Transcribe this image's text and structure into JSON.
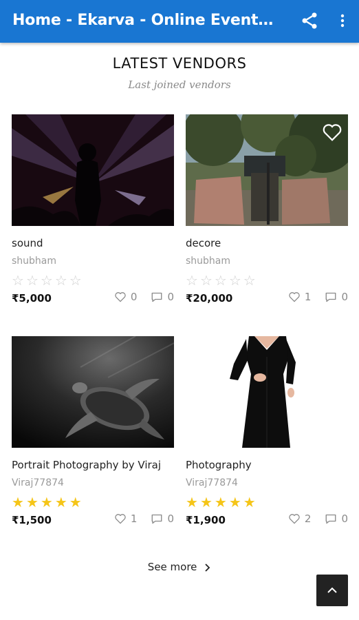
{
  "appbar": {
    "title": "Home - Ekarva - Online Events/Art Vendors",
    "share_icon": "share-icon",
    "more_icon": "more-vert-icon"
  },
  "section": {
    "title": "LATEST VENDORS",
    "subtitle": "Last joined vendors"
  },
  "colors": {
    "appbar": "#1976d2",
    "star_filled": "#f5c518",
    "star_empty": "#cfcfcf"
  },
  "cards": [
    {
      "name": "sound",
      "vendor": "shubham",
      "rating": 0,
      "price": "₹5,000",
      "likes": "0",
      "comments": "0",
      "image": "concert-silhouette-photo"
    },
    {
      "name": "decore",
      "vendor": "shubham",
      "rating": 0,
      "price": "₹20,000",
      "likes": "1",
      "comments": "0",
      "image": "outdoor-decor-photo"
    },
    {
      "name": "Portrait Photography by Viraj",
      "vendor": "Viraj77874",
      "rating": 5,
      "price": "₹1,500",
      "likes": "1",
      "comments": "0",
      "image": "sea-turtle-photo"
    },
    {
      "name": "Photography",
      "vendor": "Viraj77874",
      "rating": 5,
      "price": "₹1,900",
      "likes": "2",
      "comments": "0",
      "image": "black-dress-photo"
    }
  ],
  "see_more": {
    "label": "See more"
  },
  "scroll_top_icon": "chevron-up-icon"
}
